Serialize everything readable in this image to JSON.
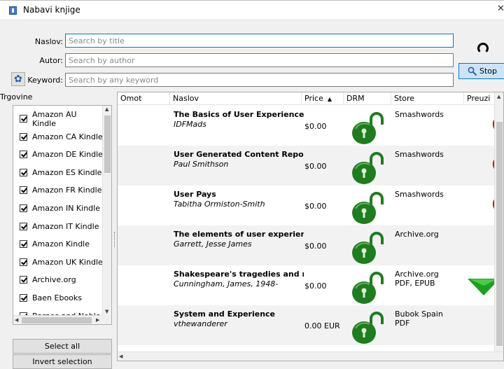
{
  "window": {
    "title": "Nabavi knjige",
    "close": "✕"
  },
  "search": {
    "title_label": "Naslov:",
    "title_placeholder": "Search by title",
    "author_label": "Autor:",
    "author_placeholder": "Search by author",
    "keyword_label": "Keyword:",
    "keyword_placeholder": "Search by any keyword",
    "stop_label": "Stop"
  },
  "stores": {
    "header": "Trgovine",
    "items": [
      {
        "label": "Amazon AU Kindle",
        "checked": true
      },
      {
        "label": "Amazon CA Kindle",
        "checked": true
      },
      {
        "label": "Amazon DE Kindle",
        "checked": true
      },
      {
        "label": "Amazon ES Kindle",
        "checked": true
      },
      {
        "label": "Amazon FR Kindle",
        "checked": true
      },
      {
        "label": "Amazon IN Kindle",
        "checked": true
      },
      {
        "label": "Amazon IT Kindle",
        "checked": true
      },
      {
        "label": "Amazon Kindle",
        "checked": true
      },
      {
        "label": "Amazon UK Kindle",
        "checked": true
      },
      {
        "label": "Archive.org",
        "checked": true
      },
      {
        "label": "Baen Ebooks",
        "checked": true
      },
      {
        "label": "Barnes and Noble",
        "checked": true
      }
    ],
    "select_all": "Select all",
    "invert_selection": "Invert selection"
  },
  "results": {
    "columns": [
      "Omot",
      "Naslov",
      "Price",
      "DRM",
      "Store",
      "Preuzi"
    ],
    "rows": [
      {
        "title": "The Basics of User Experience Design",
        "author": "IDFMads",
        "price": "$0.00",
        "store": "Smashwords",
        "formats": "",
        "drm": "locked",
        "status": "heart"
      },
      {
        "title": "User Generated Content Report",
        "author": "Paul Smithson",
        "price": "$0.00",
        "store": "Smashwords",
        "formats": "",
        "drm": "locked",
        "status": "heart"
      },
      {
        "title": "User Pays",
        "author": "Tabitha Ormiston-Smith",
        "price": "$0.00",
        "store": "Smashwords",
        "formats": "",
        "drm": "locked",
        "status": "heart"
      },
      {
        "title": "The elements of user experience : user-centered design",
        "author": "Garrett, Jesse James",
        "price": "$0.00",
        "store": "Archive.org",
        "formats": "",
        "drm": "locked",
        "status": "none"
      },
      {
        "title": "Shakespeare's tragedies and modern critics",
        "author": "Cunningham, James, 1948-",
        "price": "$0.00",
        "store": "Archive.org",
        "formats": "PDF, EPUB",
        "drm": "locked",
        "status": "download"
      },
      {
        "title": "System and Experience",
        "author": "vthewanderer",
        "price": "0.00 EUR",
        "store": "Bubok Spain",
        "formats": "PDF",
        "drm": "locked",
        "status": "none"
      }
    ]
  },
  "colors": {
    "drm_lock": "#1e7d1e",
    "heart": "#c61b1b",
    "download_arrow": "#1aa31a",
    "accent": "#0078d7"
  }
}
